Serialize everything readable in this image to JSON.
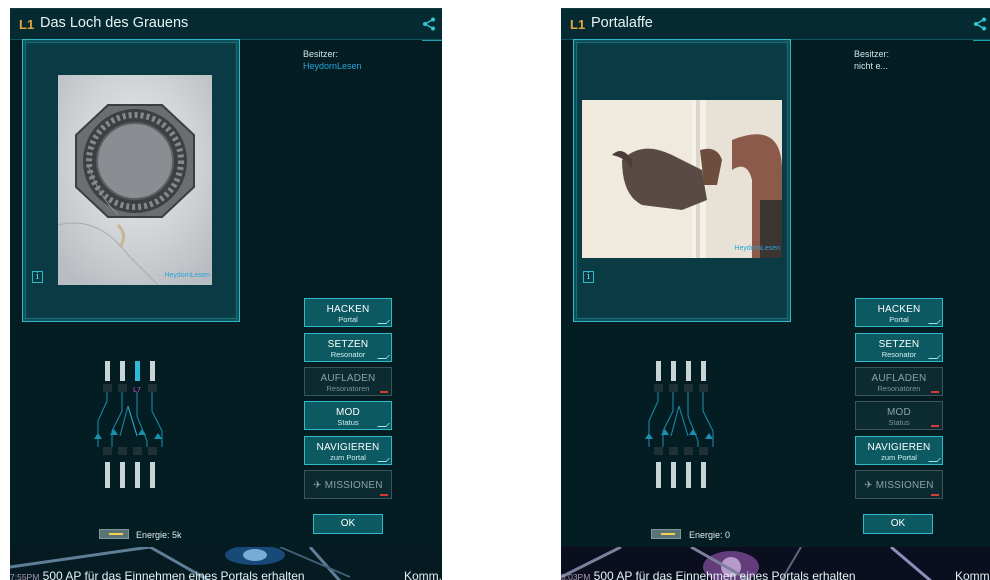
{
  "colors": {
    "background": "#041d22",
    "accent": "#31b9c8",
    "level": "#e8a53c",
    "owner_link": "#27a4d8",
    "disabled_mark": "#d83a3a"
  },
  "screens": [
    {
      "level": "L1",
      "portal_name": "Das Loch des Grauens",
      "share_icon": "share-icon",
      "owner_label": "Besitzer:",
      "owner_value": "HeydornLesen",
      "owner_color": "#27a4d8",
      "photo_caption": "HeydornLesen",
      "buttons": [
        {
          "label": "HACKEN",
          "sub": "Portal",
          "enabled": true
        },
        {
          "label": "SETZEN",
          "sub": "Resonator",
          "enabled": true
        },
        {
          "label": "AUFLADEN",
          "sub": "Resonatoren",
          "enabled": false
        },
        {
          "label": "MOD",
          "sub": "Status",
          "enabled": true
        },
        {
          "label": "NAVIGIEREN",
          "sub": "zum Portal",
          "enabled": true
        },
        {
          "label": "✈ MISSIONEN",
          "sub": "",
          "enabled": false
        }
      ],
      "resonator_level_label": "L7",
      "ok_label": "OK",
      "energy_label": "Energie: 5k",
      "comm_time": "7:55PM",
      "comm_message": "500 AP für das Einnehmen eines Portals erhalten",
      "comm_button": "Komm."
    },
    {
      "level": "L1",
      "portal_name": "Portalaffe",
      "share_icon": "share-icon",
      "owner_label": "Besitzer:",
      "owner_value": "nicht e...",
      "owner_color": "#cfe6e8",
      "photo_caption": "HeydornLesen",
      "buttons": [
        {
          "label": "HACKEN",
          "sub": "Portal",
          "enabled": true
        },
        {
          "label": "SETZEN",
          "sub": "Resonator",
          "enabled": true
        },
        {
          "label": "AUFLADEN",
          "sub": "Resonatoren",
          "enabled": false
        },
        {
          "label": "MOD",
          "sub": "Status",
          "enabled": false
        },
        {
          "label": "NAVIGIEREN",
          "sub": "zum Portal",
          "enabled": true
        },
        {
          "label": "✈ MISSIONEN",
          "sub": "",
          "enabled": false
        }
      ],
      "ok_label": "OK",
      "energy_label": "Energie: 0",
      "comm_time": "8:03PM",
      "comm_message": "500 AP für das Einnehmen eines Portals erhalten",
      "comm_button": "Komm."
    }
  ]
}
